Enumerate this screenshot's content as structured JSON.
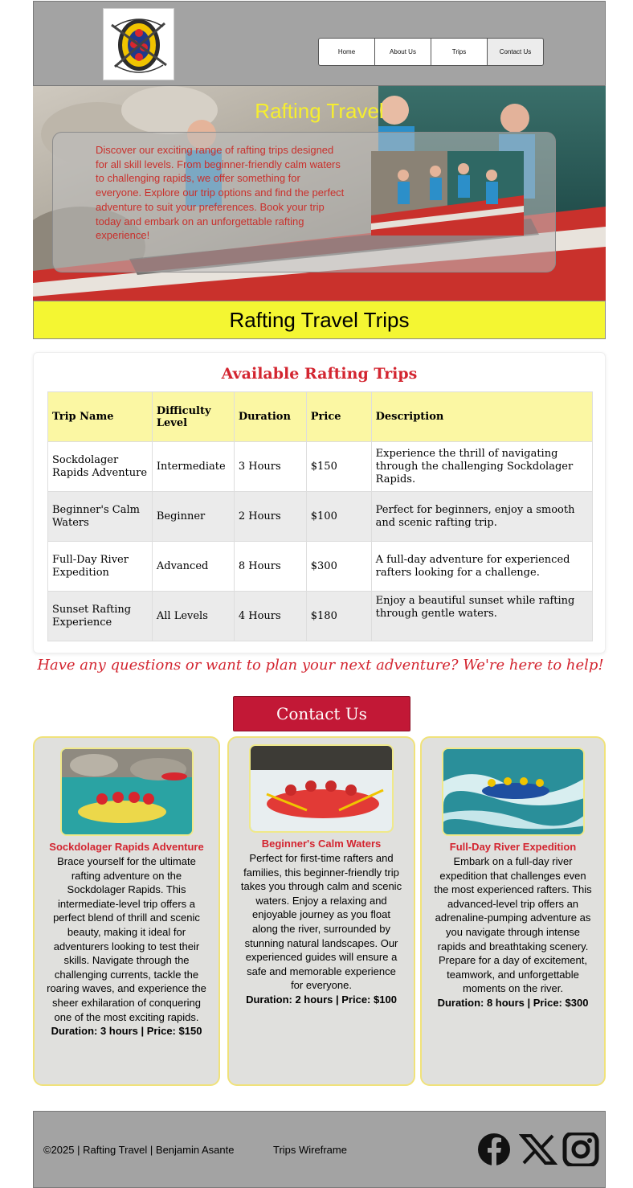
{
  "nav": {
    "items": [
      {
        "label": "Home"
      },
      {
        "label": "About Us"
      },
      {
        "label": "Trips"
      },
      {
        "label": "Contact Us"
      }
    ]
  },
  "hero": {
    "title": "Rafting Travel",
    "text": "Discover our exciting range of rafting trips designed for all skill levels. From beginner-friendly calm waters to challenging rapids, we offer something for everyone. Explore our trip options and find the perfect adventure to suit your preferences. Book your trip today and embark on an unforgettable rafting experience!"
  },
  "banner": {
    "title": "Rafting Travel Trips"
  },
  "trips": {
    "heading": "Available Rafting Trips",
    "columns": [
      "Trip Name",
      "Difficulty Level",
      "Duration",
      "Price",
      "Description"
    ],
    "rows": [
      [
        "Sockdolager Rapids Adventure",
        "Intermediate",
        "3 Hours",
        "$150",
        "Experience the thrill of navigating through the challenging Sockdolager Rapids."
      ],
      [
        "Beginner's Calm Waters",
        "Beginner",
        "2 Hours",
        "$100",
        "Perfect for beginners, enjoy a smooth and scenic rafting trip."
      ],
      [
        "Full-Day River Expedition",
        "Advanced",
        "8 Hours",
        "$300",
        "A full-day adventure for experienced rafters looking for a challenge."
      ],
      [
        "Sunset Rafting Experience",
        "All Levels",
        "4 Hours",
        "$180",
        "Enjoy a beautiful sunset while rafting through gentle waters."
      ]
    ]
  },
  "cta": {
    "text": "Have any questions or want to plan your next adventure? We're here to help!",
    "button": "Contact Us"
  },
  "cards": [
    {
      "title": "Sockdolager Rapids Adventure",
      "desc": "Brace yourself for the ultimate rafting adventure on the Sockdolager Rapids. This intermediate-level trip offers a perfect blend of thrill and scenic beauty, making it ideal for adventurers looking to test their skills. Navigate through the challenging currents, tackle the roaring waves, and experience the sheer exhilaration of conquering one of the most exciting rapids.",
      "meta": "Duration: 3 hours | Price: $150"
    },
    {
      "title": "Beginner's Calm Waters",
      "desc": "Perfect for first-time rafters and families, this beginner-friendly trip takes you through calm and scenic waters. Enjoy a relaxing and enjoyable journey as you float along the river, surrounded by stunning natural landscapes. Our experienced guides will ensure a safe and memorable experience for everyone.",
      "meta": "Duration: 2 hours | Price: $100"
    },
    {
      "title": "Full-Day River Expedition",
      "desc": "Embark on a full-day river expedition that challenges even the most experienced rafters. This advanced-level trip offers an adrenaline-pumping adventure as you navigate through intense rapids and breathtaking scenery. Prepare for a day of excitement, teamwork, and unforgettable moments on the river.",
      "meta": "Duration: 8 hours | Price: $300"
    }
  ],
  "footer": {
    "copyright": "©2025 | Rafting Travel | Benjamin Asante",
    "link": "Trips Wireframe",
    "social": [
      "facebook-icon",
      "x-icon",
      "instagram-icon"
    ]
  },
  "colors": {
    "header_bg": "#a3a3a3",
    "accent_red": "#d32530",
    "banner_yellow": "#f4f632",
    "cta_button": "#c21836",
    "card_bg": "#e0e0dd"
  }
}
